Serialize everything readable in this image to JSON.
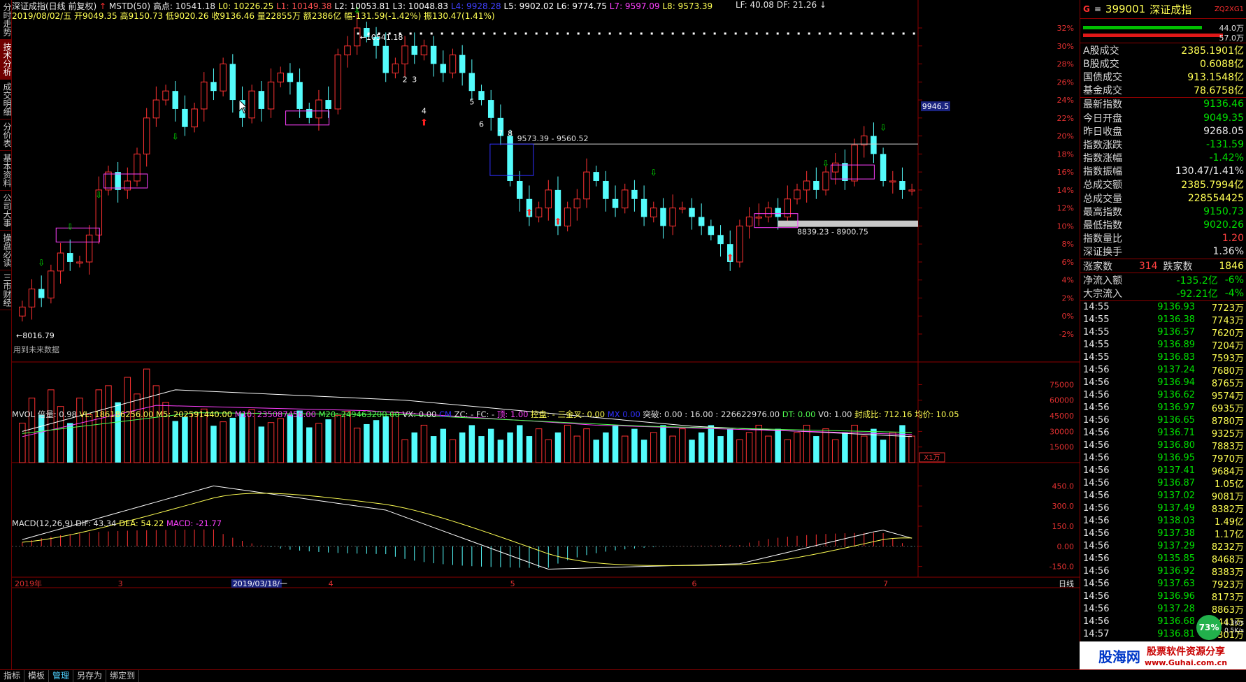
{
  "left_tabs": [
    "分时走势",
    "技术分析",
    "成交明细",
    "分价表",
    "基本资料",
    "公司大事",
    "操盘必读",
    "三市财经"
  ],
  "header": {
    "line1": {
      "name": "深证成指(日线 前复权)",
      "indicator": "MSTD(50)",
      "high_label": "高点: 10541.18",
      "levels": [
        {
          "text": "L0: 10226.25",
          "color": "#ffff54"
        },
        {
          "text": "L1: 10149.38",
          "color": "#ff5050"
        },
        {
          "text": "L2: 10053.81",
          "color": "#ffffff"
        },
        {
          "text": "L3: 10048.83",
          "color": "#ffffff"
        },
        {
          "text": "L4: 9928.28",
          "color": "#4040ff"
        },
        {
          "text": "L5: 9902.02",
          "color": "#ffffff"
        },
        {
          "text": "L6: 9774.75",
          "color": "#ffffff"
        },
        {
          "text": "L7: 9597.09",
          "color": "#ff40ff"
        },
        {
          "text": "L8: 9573.39",
          "color": "#ffff54"
        }
      ],
      "lf": "LF: 40.08",
      "df": "DF: 21.26"
    },
    "line2": "2019/08/02/五 开9049.35 高9150.73 低9020.26 收9136.46 量22855万 额2386亿 幅-131.59(-1.42%) 振130.47(1.41%)"
  },
  "price_axis": [
    "32%",
    "30%",
    "28%",
    "26%",
    "24%",
    "22%",
    "20%",
    "18%",
    "16%",
    "14%",
    "12%",
    "10%",
    "8%",
    "6%",
    "4%",
    "2%",
    "0%",
    "-2%"
  ],
  "price_tag": "9946.5",
  "annotations": {
    "high": "10541.18",
    "low": "8016.79",
    "box1": "9573.39 - 9560.52",
    "box2": "8839.23 - 8900.75",
    "future_note": "用到未来数据",
    "wave_nums": [
      "2",
      "3",
      "4",
      "5",
      "6",
      "7",
      "8"
    ]
  },
  "volume": {
    "label_parts": [
      {
        "text": "MVOL 倍量: 0.98",
        "color": "#e0e0e0"
      },
      {
        "text": "VL: 186186256.00",
        "color": "#ffff54"
      },
      {
        "text": "M5: 202591440.00",
        "color": "#ffff54"
      },
      {
        "text": "M10: 235087456.00",
        "color": "#ff40ff"
      },
      {
        "text": "M20: 249463200.00",
        "color": "#50ff50"
      },
      {
        "text": "VX: 0.00",
        "color": "#e0e0e0"
      },
      {
        "text": "CM",
        "color": "#3030ff"
      },
      {
        "text": "ZC: - FC: -",
        "color": "#e0e0e0"
      },
      {
        "text": "顶: 1.00",
        "color": "#ff40ff"
      },
      {
        "text": "控盘: - 三金叉: 0.00",
        "color": "#ffff54"
      },
      {
        "text": "MX 0.00",
        "color": "#3030ff"
      },
      {
        "text": "突破: 0.00 : 16.00",
        "color": "#e0e0e0"
      },
      {
        "text": ": 226622976.00",
        "color": "#e0e0e0"
      },
      {
        "text": "DT: 0.00",
        "color": "#50ff50"
      },
      {
        "text": "V0: 1.00",
        "color": "#e0e0e0"
      },
      {
        "text": "封成比: 712.16",
        "color": "#ffff54"
      },
      {
        "text": "均价: 10.05",
        "color": "#ffff54"
      }
    ],
    "axis": [
      "75000",
      "60000",
      "45000",
      "30000",
      "15000"
    ],
    "unit": "X1万"
  },
  "macd": {
    "label_parts": [
      {
        "text": "MACD(12,26,9)",
        "color": "#e0e0e0"
      },
      {
        "text": "DIF: 43.34",
        "color": "#e0e0e0"
      },
      {
        "text": "DEA: 54.22",
        "color": "#ffff54"
      },
      {
        "text": "MACD: -21.77",
        "color": "#ff40ff"
      }
    ],
    "axis": [
      "450.0",
      "300.0",
      "150.0",
      "0.00",
      "-150.0"
    ]
  },
  "date_axis": [
    "2019年",
    "3",
    "2019/03/18/一",
    "4",
    "5",
    "6",
    "7"
  ],
  "period": "日线",
  "right_panel": {
    "code": "399001",
    "name": "深证成指",
    "tag": "ZQ2XG1",
    "bar_vals": [
      "44.0万",
      "57.0万"
    ],
    "rows1": [
      {
        "k": "A股成交",
        "v": "2385.1901亿",
        "c": "#ffff54"
      },
      {
        "k": "B股成交",
        "v": "0.6088亿",
        "c": "#ffff54"
      },
      {
        "k": "国债成交",
        "v": "913.1548亿",
        "c": "#ffff54"
      },
      {
        "k": "基金成交",
        "v": "78.6758亿",
        "c": "#ffff54"
      }
    ],
    "rows2": [
      {
        "k": "最新指数",
        "v": "9136.46",
        "c": "#00e000"
      },
      {
        "k": "今日开盘",
        "v": "9049.35",
        "c": "#00e000"
      },
      {
        "k": "昨日收盘",
        "v": "9268.05",
        "c": "#e8e8e8"
      },
      {
        "k": "指数涨跌",
        "v": "-131.59",
        "c": "#00e000"
      },
      {
        "k": "指数涨幅",
        "v": "-1.42%",
        "c": "#00e000"
      },
      {
        "k": "指数振幅",
        "v": "130.47/1.41%",
        "c": "#e8e8e8"
      },
      {
        "k": "总成交额",
        "v": "2385.7994亿",
        "c": "#ffff54"
      },
      {
        "k": "总成交量",
        "v": "228554425",
        "c": "#ffff54"
      },
      {
        "k": "最高指数",
        "v": "9150.73",
        "c": "#00e000"
      },
      {
        "k": "最低指数",
        "v": "9020.26",
        "c": "#00e000"
      },
      {
        "k": "指数量比",
        "v": "1.20",
        "c": "#ff4040"
      },
      {
        "k": "深证换手",
        "v": "1.36%",
        "c": "#e8e8e8"
      }
    ],
    "updown": {
      "up_label": "涨家数",
      "up": "314",
      "down_label": "跌家数",
      "down": "1846"
    },
    "flows": [
      {
        "k": "净流入额",
        "v": "-135.2亿",
        "p": "-6%"
      },
      {
        "k": "大宗流入",
        "v": "-92.21亿",
        "p": "-4%"
      }
    ],
    "ticks": [
      [
        "14:55",
        "9136.93",
        "7723万"
      ],
      [
        "14:55",
        "9136.38",
        "7743万"
      ],
      [
        "14:55",
        "9136.57",
        "7620万"
      ],
      [
        "14:55",
        "9136.89",
        "7204万"
      ],
      [
        "14:55",
        "9136.83",
        "7593万"
      ],
      [
        "14:56",
        "9137.24",
        "7680万"
      ],
      [
        "14:56",
        "9136.94",
        "8765万"
      ],
      [
        "14:56",
        "9136.62",
        "9574万"
      ],
      [
        "14:56",
        "9136.97",
        "6935万"
      ],
      [
        "14:56",
        "9136.65",
        "8780万"
      ],
      [
        "14:56",
        "9136.71",
        "9325万"
      ],
      [
        "14:56",
        "9136.80",
        "7883万"
      ],
      [
        "14:56",
        "9136.95",
        "7970万"
      ],
      [
        "14:56",
        "9137.41",
        "9684万"
      ],
      [
        "14:56",
        "9136.87",
        "1.05亿"
      ],
      [
        "14:56",
        "9137.02",
        "9081万"
      ],
      [
        "14:56",
        "9137.49",
        "8382万"
      ],
      [
        "14:56",
        "9138.03",
        "1.49亿"
      ],
      [
        "14:56",
        "9137.38",
        "1.17亿"
      ],
      [
        "14:56",
        "9137.29",
        "8232万"
      ],
      [
        "14:56",
        "9135.85",
        "8468万"
      ],
      [
        "14:56",
        "9136.92",
        "8383万"
      ],
      [
        "14:56",
        "9137.63",
        "7923万"
      ],
      [
        "14:56",
        "9136.96",
        "8173万"
      ],
      [
        "14:56",
        "9137.28",
        "8863万"
      ],
      [
        "14:56",
        "9136.68",
        "8441万"
      ],
      [
        "14:57",
        "9136.81",
        "8301万"
      ]
    ],
    "speed": {
      "pct": "73%",
      "up": "1.3K/s",
      "down": "0.5K/s"
    }
  },
  "banner": {
    "site": "股海网",
    "slogan": "股票软件资源分享",
    "url": "www.Guhai.com.cn"
  },
  "bottom_bar": [
    "指标",
    "模板",
    "管理",
    "另存为",
    "绑定到"
  ],
  "chart_data": {
    "type": "candlestick",
    "title": "深证成指(日线 前复权)",
    "period": "2019-01 to 2019-08",
    "price_range_pct": [
      -2,
      32
    ],
    "high": 10541.18,
    "low": 8016.79,
    "last_close": 9136.46,
    "closes_pct": [
      1,
      3,
      2,
      5,
      7,
      6,
      6,
      9,
      14,
      16,
      14,
      15,
      18,
      22,
      24,
      25,
      23,
      21,
      23,
      26,
      25,
      28,
      24,
      22,
      25,
      23,
      26,
      27,
      26,
      23,
      22,
      24,
      23,
      29,
      30,
      32,
      31,
      30,
      27,
      28,
      30,
      29,
      30,
      28,
      27,
      29,
      27,
      25,
      24,
      22,
      20,
      15,
      13,
      11,
      12,
      14,
      10,
      12,
      13,
      16,
      15,
      13,
      12,
      14,
      13,
      11,
      12,
      10,
      12,
      12,
      11,
      10,
      9,
      8,
      6,
      10,
      11,
      11,
      12,
      11,
      13,
      14,
      15,
      14,
      16,
      17,
      15,
      19,
      20,
      18,
      15,
      15,
      14,
      14
    ]
  }
}
